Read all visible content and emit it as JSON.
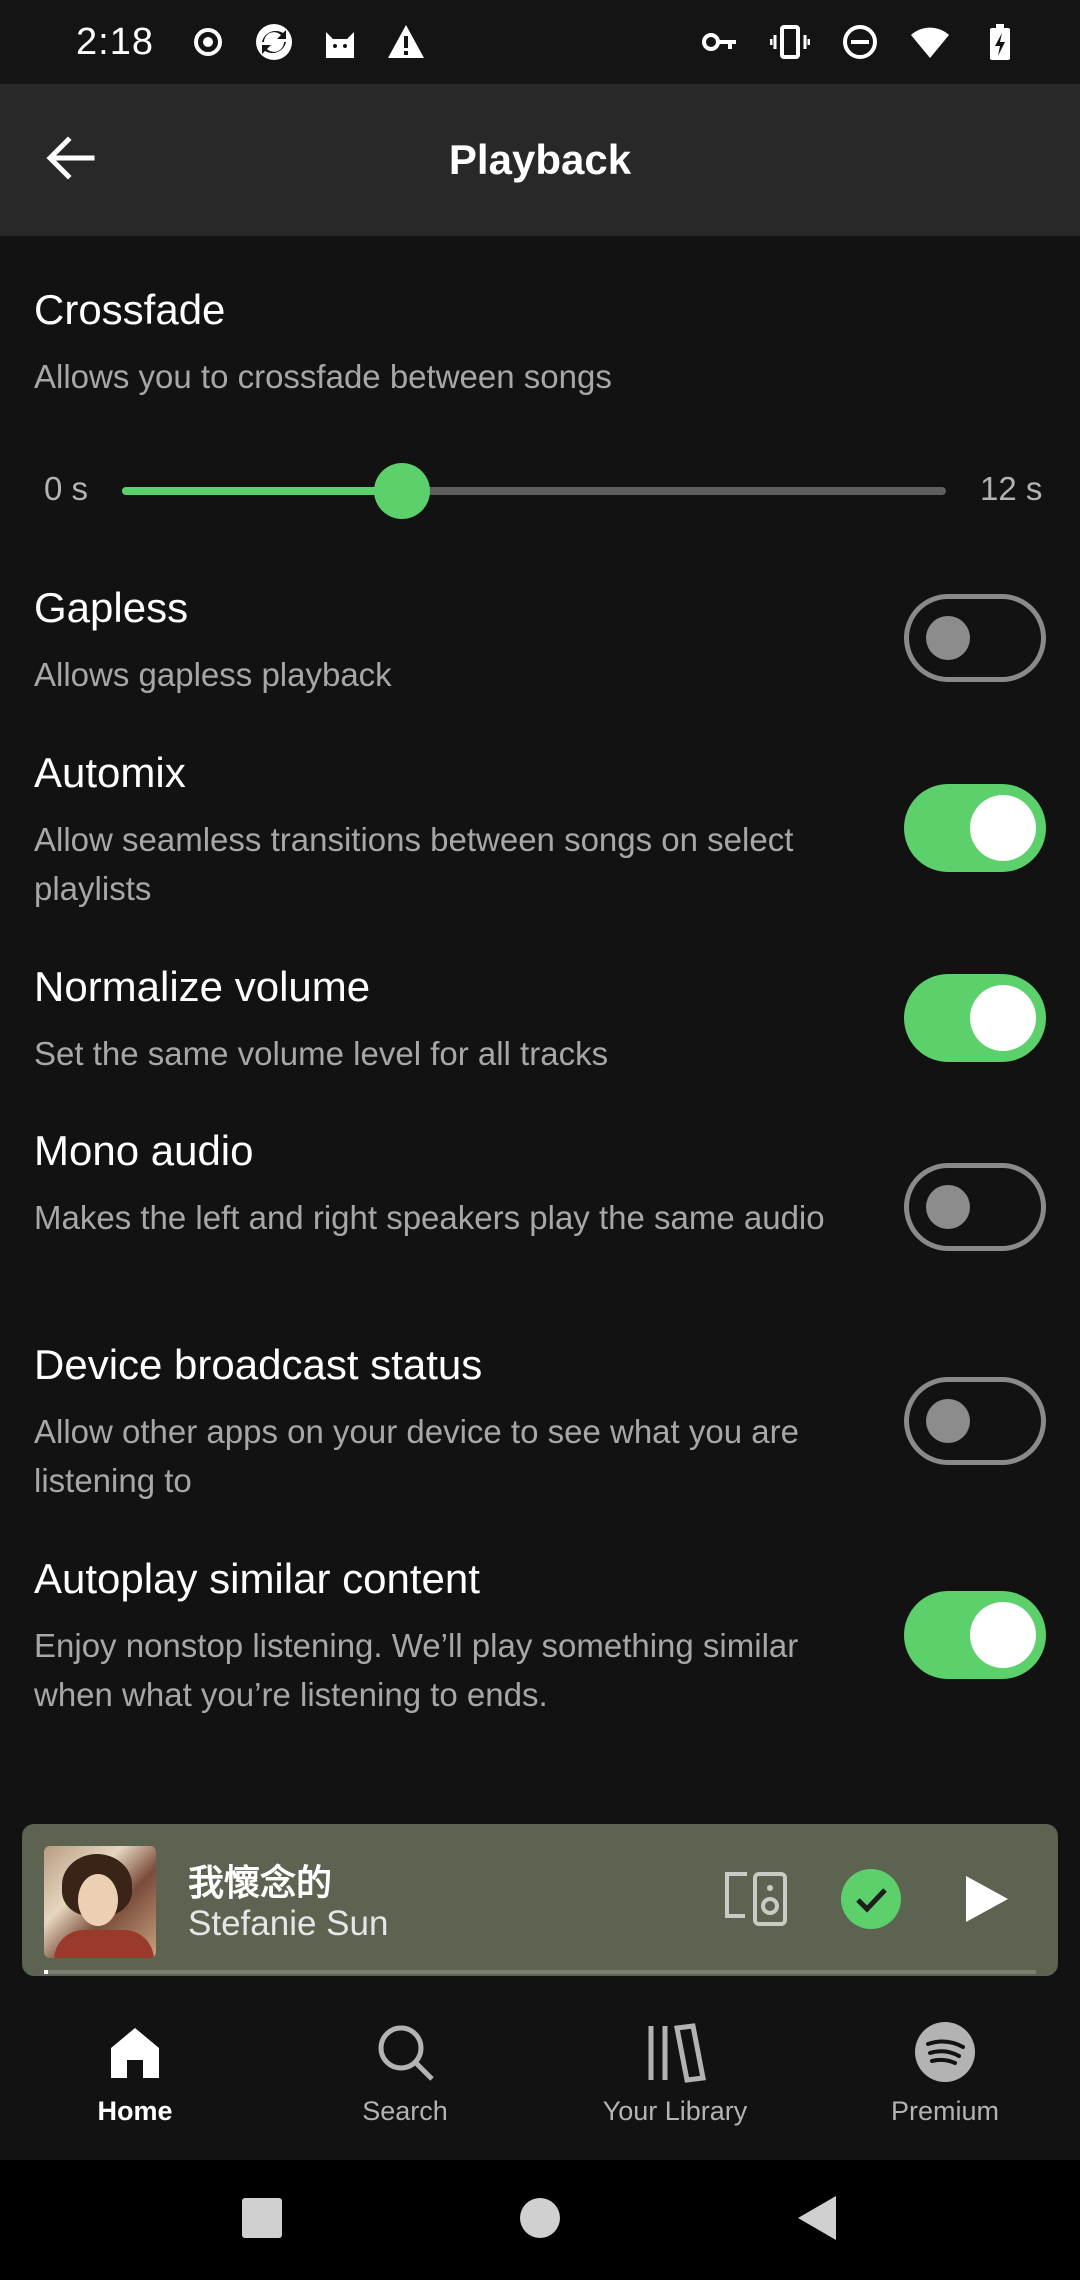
{
  "status_bar": {
    "time": "2:18",
    "left_icons": [
      "record-icon",
      "sync-icon",
      "cat-icon",
      "warning-icon"
    ],
    "right_icons": [
      "key-icon",
      "vibrate-icon",
      "dnd-icon",
      "wifi-icon",
      "battery-charging-icon"
    ]
  },
  "header": {
    "title": "Playback",
    "back_icon": "back-arrow-icon"
  },
  "crossfade": {
    "title": "Crossfade",
    "description": "Allows you to crossfade between songs",
    "min_label": "0 s",
    "max_label": "12 s",
    "value_fraction": 0.34
  },
  "settings": [
    {
      "title": "Gapless",
      "description": "Allows gapless playback",
      "enabled": false
    },
    {
      "title": "Automix",
      "description": "Allow seamless transitions between songs on select playlists",
      "enabled": true
    },
    {
      "title": "Normalize volume",
      "description": "Set the same volume level for all tracks",
      "enabled": true
    },
    {
      "title": "Mono audio",
      "description": "Makes the left and right speakers play the same audio",
      "enabled": false
    },
    {
      "title": "Device broadcast status",
      "description": "Allow other apps on your device to see what you are listening to",
      "enabled": false
    },
    {
      "title": "Autoplay similar content",
      "description": "Enjoy nonstop listening. We’ll play something similar when what you’re listening to ends.",
      "enabled": true
    }
  ],
  "mini_player": {
    "track_title": "我懷念的",
    "artist": "Stefanie Sun",
    "progress_fraction": 0.004,
    "background_color": "#5c6350",
    "icons": [
      "connect-device-icon",
      "liked-check-icon",
      "play-icon"
    ]
  },
  "bottom_nav": [
    {
      "label": "Home",
      "icon": "home-icon",
      "active": true
    },
    {
      "label": "Search",
      "icon": "search-icon",
      "active": false
    },
    {
      "label": "Your Library",
      "icon": "library-icon",
      "active": false
    },
    {
      "label": "Premium",
      "icon": "spotify-icon",
      "active": false
    }
  ],
  "colors": {
    "accent": "#5bd06b",
    "background": "#121212",
    "header": "#282828"
  }
}
